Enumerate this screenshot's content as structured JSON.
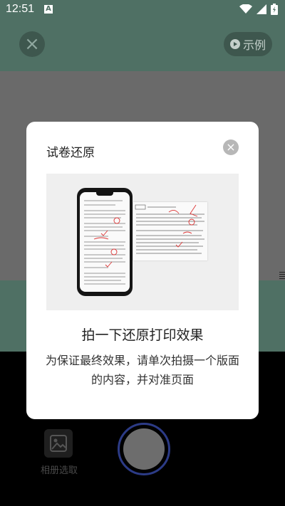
{
  "status_bar": {
    "time": "12:51",
    "notification_badge": "A"
  },
  "toolbar": {
    "example_label": "示例"
  },
  "bottom_bar": {
    "album_label": "相册选取"
  },
  "dialog": {
    "title": "试卷还原",
    "headline": "拍一下还原打印效果",
    "description": "为保证最终效果，请单次拍摄一个版面的内容，并对准页面"
  },
  "colors": {
    "accent_green": "#4f7064",
    "shutter_ring": "#2c3b86"
  }
}
